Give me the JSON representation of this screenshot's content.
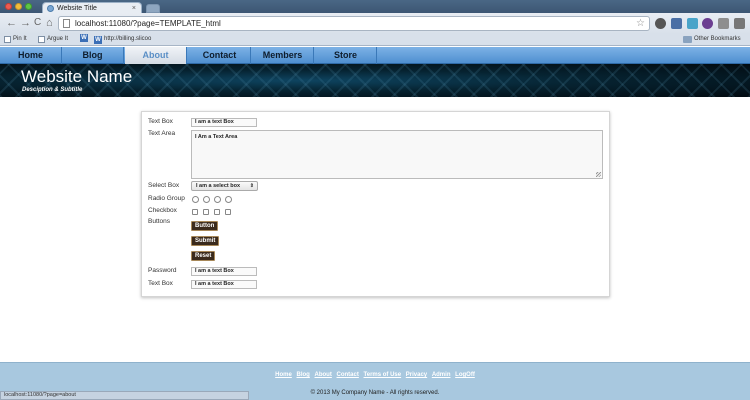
{
  "browser": {
    "tab_title": "Website Title",
    "tab_close": "×",
    "url": "localhost:11080/?page=TEMPLATE_html",
    "back": "←",
    "forward": "→",
    "reload": "C",
    "home": "⌂",
    "star": "☆",
    "bookmarks": [
      {
        "label": "Pin It",
        "icon": "page-icon"
      },
      {
        "label": "Argue It",
        "icon": "page-icon"
      },
      {
        "label": "",
        "icon": "w-icon"
      },
      {
        "label": "http://billing.slicoo",
        "icon": "w-icon"
      }
    ],
    "other_bookmarks": "Other Bookmarks",
    "status_url": "localhost:11080/?page=about"
  },
  "nav": {
    "items": [
      {
        "label": "Home"
      },
      {
        "label": "Blog"
      },
      {
        "label": "About"
      },
      {
        "label": "Contact"
      },
      {
        "label": "Members"
      },
      {
        "label": "Store"
      }
    ],
    "active": "About"
  },
  "header": {
    "title": "Website Name",
    "subtitle": "Desciption & Subtitle"
  },
  "form": {
    "textbox_label": "Text Box",
    "textbox_value": "I am a text Box",
    "textarea_label": "Text Area",
    "textarea_value": "I Am a Text Area",
    "select_label": "Select Box",
    "select_value": "I am a select box",
    "select_arrow": "⇕",
    "radio_label": "Radio Group",
    "radio_count": 4,
    "checkbox_label": "Checkbox",
    "checkbox_count": 4,
    "buttons_label": "Buttons",
    "button_label": "Button",
    "submit_label": "Submit",
    "reset_label": "Reset",
    "password_label": "Password",
    "password_value": "I am a text Box",
    "textbox2_label": "Text Box",
    "textbox2_value": "I am a text Box"
  },
  "footer": {
    "links": [
      "Home",
      "Blog",
      "About",
      "Contact",
      "Terms of Use",
      "Privacy",
      "Admin",
      "LogOff"
    ],
    "copyright": "© 2013 My Company Name - All rights reserved."
  },
  "colors": {
    "nav_top": "#7db2e6",
    "nav_bottom": "#4f8fd0",
    "banner_dark": "#062331",
    "button_bg": "#3a2a1c",
    "footer_bg": "#a8c8df"
  }
}
